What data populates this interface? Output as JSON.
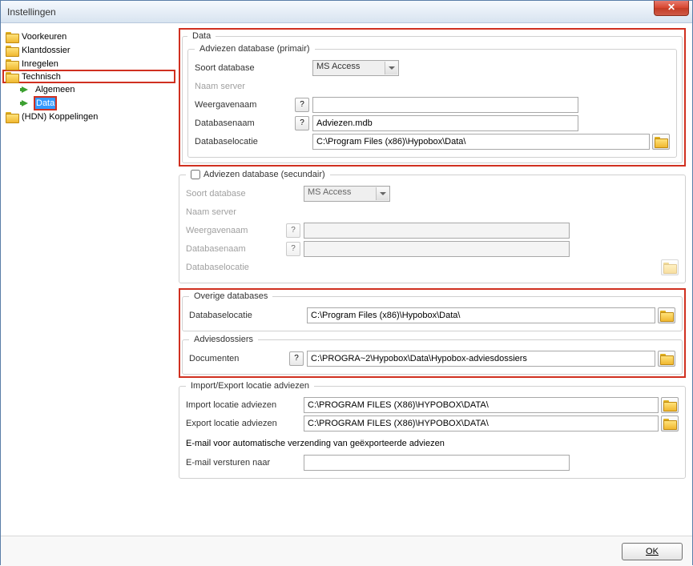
{
  "window": {
    "title": "Instellingen"
  },
  "sidebar": {
    "items": [
      {
        "label": "Voorkeuren"
      },
      {
        "label": "Klantdossier"
      },
      {
        "label": "Inregelen"
      },
      {
        "label": "Technisch"
      },
      {
        "label": "Algemeen"
      },
      {
        "label": "Data"
      },
      {
        "label": "(HDN) Koppelingen"
      }
    ]
  },
  "main": {
    "data_legend": "Data",
    "primary": {
      "legend": "Adviezen database (primair)",
      "soort_label": "Soort database",
      "soort_value": "MS Access",
      "naam_server_label": "Naam server",
      "weergavenaam_label": "Weergavenaam",
      "databasenaam_label": "Databasenaam",
      "databasenaam_value": "Adviezen.mdb",
      "databaselocatie_label": "Databaselocatie",
      "databaselocatie_value": "C:\\Program Files (x86)\\Hypobox\\Data\\"
    },
    "secondary": {
      "legend": "Adviezen database (secundair)",
      "soort_label": "Soort database",
      "soort_value": "MS Access",
      "naam_server_label": "Naam server",
      "weergavenaam_label": "Weergavenaam",
      "databasenaam_label": "Databasenaam",
      "databaselocatie_label": "Databaselocatie"
    },
    "overige": {
      "legend": "Overige databases",
      "databaselocatie_label": "Databaselocatie",
      "databaselocatie_value": "C:\\Program Files (x86)\\Hypobox\\Data\\"
    },
    "adviesdossiers": {
      "legend": "Adviesdossiers",
      "documenten_label": "Documenten",
      "documenten_value": "C:\\PROGRA~2\\Hypobox\\Data\\Hypobox-adviesdossiers"
    },
    "importexport": {
      "legend": "Import/Export locatie adviezen",
      "import_label": "Import locatie adviezen",
      "import_value": "C:\\PROGRAM FILES (X86)\\HYPOBOX\\DATA\\",
      "export_label": "Export locatie adviezen",
      "export_value": "C:\\PROGRAM FILES (X86)\\HYPOBOX\\DATA\\",
      "email_info": "E-mail voor automatische verzending van geëxporteerde adviezen",
      "email_label": "E-mail versturen naar"
    }
  },
  "footer": {
    "ok_label": "OK"
  },
  "help_symbol": "?"
}
